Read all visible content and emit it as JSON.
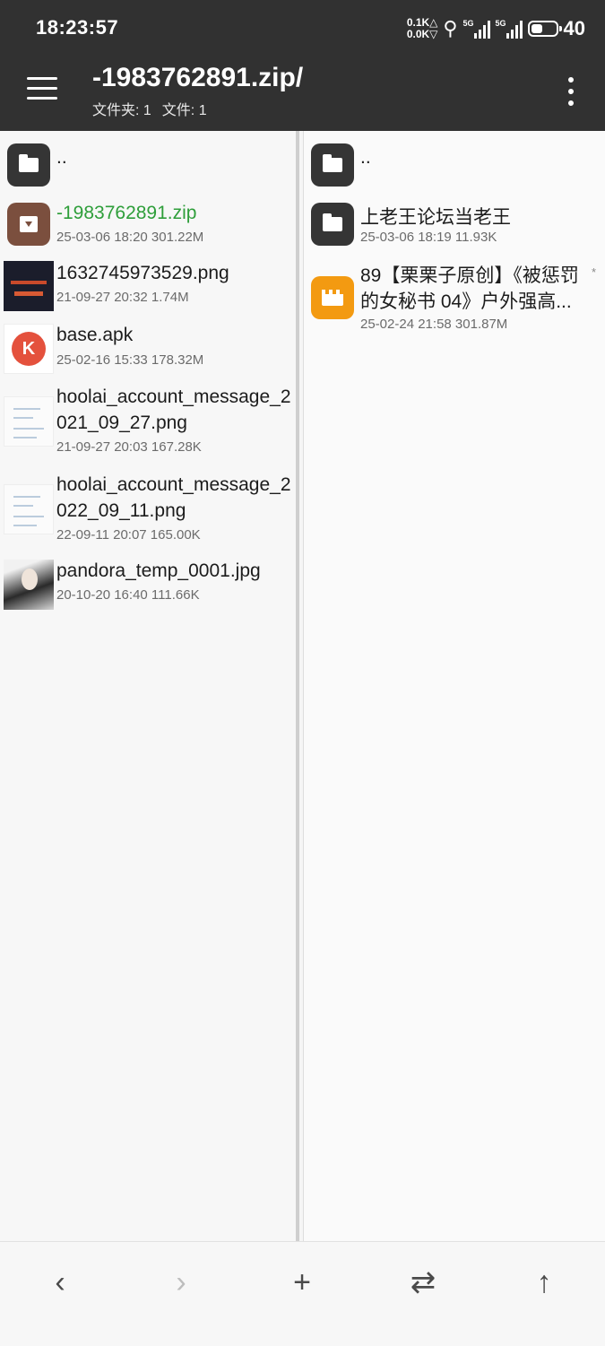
{
  "status_bar": {
    "time": "18:23:57",
    "net_up": "0.1K△",
    "net_down": "0.0K▽",
    "signal1_label": "5G",
    "signal2_label": "5G",
    "battery": "40"
  },
  "header": {
    "title": "-1983762891.zip/",
    "folders_label": "文件夹: 1",
    "files_label": "文件: 1"
  },
  "left_pane": {
    "parent": "..",
    "items": [
      {
        "name": "-1983762891.zip",
        "meta": "25-03-06 18:20  301.22M",
        "icon": "archive-icon"
      },
      {
        "name": "1632745973529.png",
        "meta": "21-09-27 20:32  1.74M",
        "icon": "image-thumbnail"
      },
      {
        "name": "base.apk",
        "meta": "25-02-16 15:33  178.32M",
        "icon": "app-icon"
      },
      {
        "name": "hoolai_account_message_2021_09_27.png",
        "meta": "21-09-27 20:03  167.28K",
        "icon": "image-thumbnail"
      },
      {
        "name": "hoolai_account_message_2022_09_11.png",
        "meta": "22-09-11 20:07  165.00K",
        "icon": "image-thumbnail"
      },
      {
        "name": "pandora_temp_0001.jpg",
        "meta": "20-10-20 16:40  111.66K",
        "icon": "image-thumbnail"
      }
    ]
  },
  "right_pane": {
    "parent": "..",
    "items": [
      {
        "name": "上老王论坛当老王",
        "meta": "25-03-06 18:19  11.93K",
        "icon": "folder-icon"
      },
      {
        "name": "89【栗栗子原创】《被惩罚的女秘书 04》户外强高...",
        "meta": "25-02-24 21:58  301.87M",
        "icon": "video-icon",
        "marker": "*"
      }
    ]
  },
  "bottom_bar": {
    "back": "‹",
    "forward": "›",
    "add": "+",
    "swap": "⇄",
    "up": "↑"
  }
}
